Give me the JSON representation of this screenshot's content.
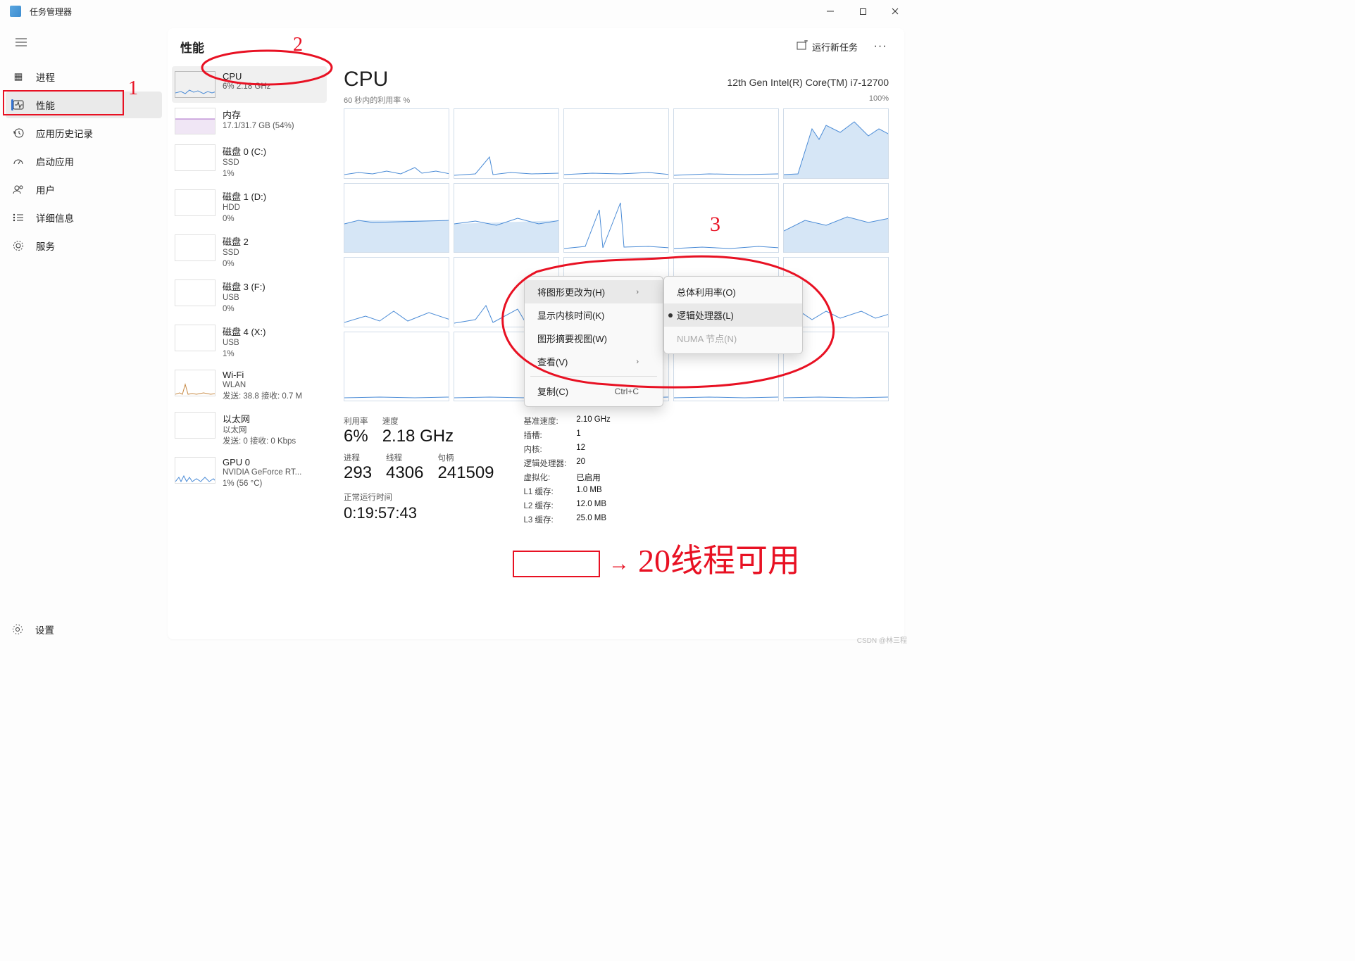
{
  "app": {
    "title": "任务管理器"
  },
  "window": {
    "min": "—",
    "max": "□",
    "close": "✕"
  },
  "sidebar": {
    "items": [
      {
        "label": "进程"
      },
      {
        "label": "性能"
      },
      {
        "label": "应用历史记录"
      },
      {
        "label": "启动应用"
      },
      {
        "label": "用户"
      },
      {
        "label": "详细信息"
      },
      {
        "label": "服务"
      }
    ],
    "settings": "设置"
  },
  "header": {
    "title": "性能",
    "run_task": "运行新任务",
    "more": "···"
  },
  "perf": {
    "cpu": {
      "title": "CPU",
      "sub": "6%  2.18 GHz"
    },
    "mem": {
      "title": "内存",
      "sub": "17.1/31.7 GB (54%)"
    },
    "d0": {
      "title": "磁盘 0 (C:)",
      "sub1": "SSD",
      "sub2": "1%"
    },
    "d1": {
      "title": "磁盘 1 (D:)",
      "sub1": "HDD",
      "sub2": "0%"
    },
    "d2": {
      "title": "磁盘 2",
      "sub1": "SSD",
      "sub2": "0%"
    },
    "d3": {
      "title": "磁盘 3 (F:)",
      "sub1": "USB",
      "sub2": "0%"
    },
    "d4": {
      "title": "磁盘 4 (X:)",
      "sub1": "USB",
      "sub2": "1%"
    },
    "wifi": {
      "title": "Wi-Fi",
      "sub1": "WLAN",
      "sub2": "发送: 38.8 接收: 0.7 M"
    },
    "eth": {
      "title": "以太网",
      "sub1": "以太网",
      "sub2": "发送: 0 接收: 0 Kbps"
    },
    "gpu": {
      "title": "GPU 0",
      "sub1": "NVIDIA GeForce RT...",
      "sub2": "1% (56 °C)"
    }
  },
  "detail": {
    "title": "CPU",
    "model": "12th Gen Intel(R) Core(TM) i7-12700",
    "chart_label": "60 秒内的利用率 %",
    "chart_max": "100%"
  },
  "stats": {
    "util_l": "利用率",
    "util_v": "6%",
    "speed_l": "速度",
    "speed_v": "2.18 GHz",
    "proc_l": "进程",
    "proc_v": "293",
    "thr_l": "线程",
    "thr_v": "4306",
    "hnd_l": "句柄",
    "hnd_v": "241509",
    "uptime_l": "正常运行时间",
    "uptime_v": "0:19:57:43"
  },
  "specs": {
    "base_l": "基准速度:",
    "base_v": "2.10 GHz",
    "sock_l": "插槽:",
    "sock_v": "1",
    "core_l": "内核:",
    "core_v": "12",
    "lp_l": "逻辑处理器:",
    "lp_v": "20",
    "virt_l": "虚拟化:",
    "virt_v": "已启用",
    "l1_l": "L1 缓存:",
    "l1_v": "1.0 MB",
    "l2_l": "L2 缓存:",
    "l2_v": "12.0 MB",
    "l3_l": "L3 缓存:",
    "l3_v": "25.0 MB"
  },
  "ctx1": {
    "change": "将图形更改为(H)",
    "kernel": "显示内核时间(K)",
    "summary": "图形摘要视图(W)",
    "view": "查看(V)",
    "copy": "复制(C)",
    "copy_sc": "Ctrl+C"
  },
  "ctx2": {
    "overall": "总体利用率(O)",
    "logical": "逻辑处理器(L)",
    "numa": "NUMA 节点(N)"
  },
  "annot": {
    "n1": "1",
    "n2": "2",
    "n3": "3",
    "arrow": "→",
    "txt": "20线程可用"
  },
  "watermark": "CSDN @林三程"
}
